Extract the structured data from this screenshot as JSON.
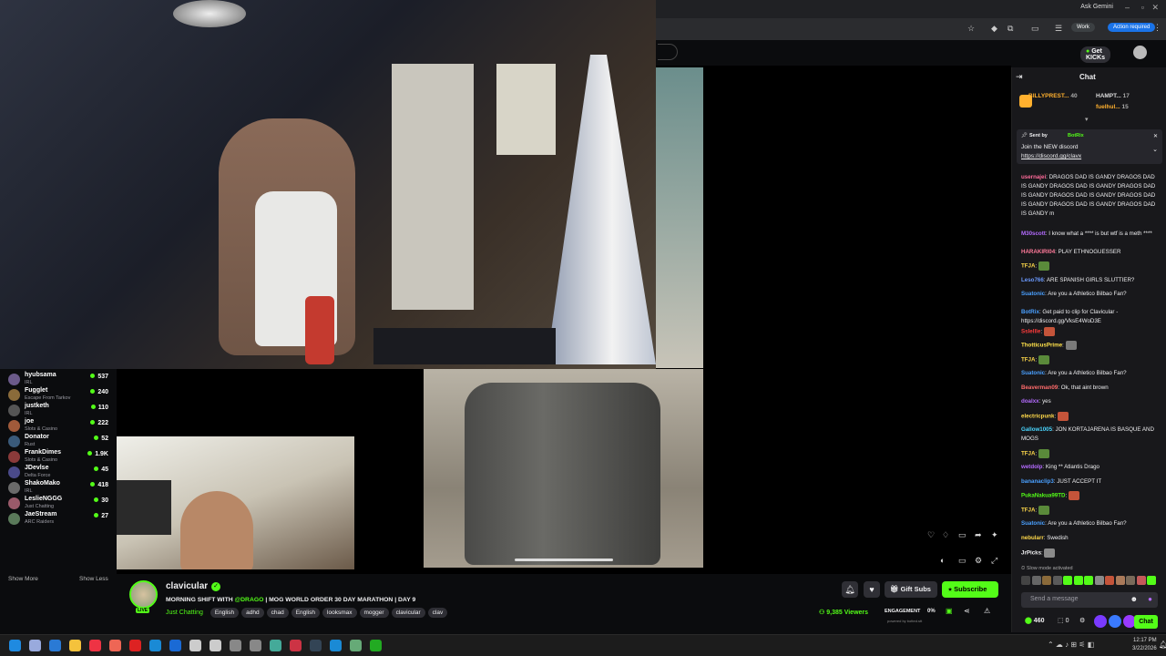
{
  "browser": {
    "ask_gemini": "Ask Gemini",
    "profile_chip": "Work",
    "action_required": "Action required"
  },
  "kick": {
    "get_kicks": "Get KICKs"
  },
  "sidebar": {
    "channels": [
      {
        "name": "hyubsama",
        "category": "IRL",
        "viewers": "537",
        "color": "#6b5a8a"
      },
      {
        "name": "Fugglet",
        "category": "Escape From Tarkov",
        "viewers": "240",
        "color": "#8a6b3a"
      },
      {
        "name": "justketh",
        "category": "IRL",
        "viewers": "110",
        "color": "#555"
      },
      {
        "name": "joe",
        "category": "Slots & Casino",
        "viewers": "222",
        "color": "#a05a3a"
      },
      {
        "name": "Donator",
        "category": "Rust",
        "viewers": "52",
        "color": "#3a5a7a"
      },
      {
        "name": "FrankDimes",
        "category": "Slots & Casino",
        "viewers": "1.9K",
        "color": "#8a3a3a"
      },
      {
        "name": "JDevlse",
        "category": "Delta Force",
        "viewers": "45",
        "color": "#4a4a8a"
      },
      {
        "name": "ShakoMako",
        "category": "IRL",
        "viewers": "418",
        "color": "#6a6a6a"
      },
      {
        "name": "LeslieNGGG",
        "category": "Just Chatting",
        "viewers": "30",
        "color": "#9a5a6a"
      },
      {
        "name": "JaeStream",
        "category": "ARC Raiders",
        "viewers": "27",
        "color": "#5a7a5a"
      }
    ],
    "show_more": "Show More",
    "show_less": "Show Less"
  },
  "stream": {
    "live_badge": "LIVE",
    "streamer": "clavicular",
    "title_prefix": "MORNING SHIFT WITH",
    "title_mention": "@DRAGO",
    "title_suffix": "| MOG WORLD ORDER 30 DAY MARATHON | DAY 9",
    "category": "Just Chatting",
    "tags": [
      "English",
      "adhd",
      "chad",
      "English",
      "looksmax",
      "mogger",
      "clavicular",
      "clav"
    ],
    "viewers": "9,385 Viewers",
    "engagement_label": "ENGAGEMENT",
    "engagement_value": "0%",
    "powered_by": "powered by botted.stt",
    "gift_subs": "Gift Subs",
    "subscribe": "Subscribe"
  },
  "chat": {
    "header": "Chat",
    "leaders": [
      {
        "name": "BILLYPREST...",
        "points": "40"
      },
      {
        "name": "HAMPT...",
        "points": "17"
      },
      {
        "name": "fuelhul...",
        "points": "15"
      }
    ],
    "pinned": {
      "sent_by": "Sent by",
      "bot": "BotRix",
      "line1": "Join the NEW discord",
      "link": "https://discord.gg/clavx"
    },
    "messages": [
      {
        "user": "usernajei",
        "color": "#ff6b9a",
        "text": "DRAGOS DAD IS GANDY DRAGOS DAD IS GANDY DRAGOS DAD IS GANDY DRAGOS DAD IS GANDY DRAGOS DAD IS GANDY DRAGOS DAD IS GANDY DRAGOS DAD IS GANDY DRAGOS DAD IS GANDY m"
      },
      {
        "user": "M30scott",
        "color": "#b46bff",
        "text": "I know what a **** is but wtf is a meth ****"
      },
      {
        "user": "HARAKIRI04",
        "color": "#ff7a9a",
        "text": "PLAY ETHNOGUESSER"
      },
      {
        "user": "TFJA",
        "color": "#ffd94a",
        "text": ""
      },
      {
        "user": "Leso766",
        "color": "#6b9aff",
        "text": "ARE SPANISH GIRLS SLUTTIER?"
      },
      {
        "user": "Suatonic",
        "color": "#4aa0ff",
        "text": "Are you a Athletico Bilbao Fan?"
      },
      {
        "user": "BotRix",
        "color": "#4aa0ff",
        "text": "Get paid to clip for Clavicular - https://discord.gg/VksE4WoD3E"
      },
      {
        "user": "Sslellle",
        "color": "#ff3b3b",
        "text": ""
      },
      {
        "user": "ThotticusPrime",
        "color": "#ffe14a",
        "text": ""
      },
      {
        "user": "TFJA",
        "color": "#ffd94a",
        "text": ""
      },
      {
        "user": "Suatonic",
        "color": "#4aa0ff",
        "text": "Are you a Athletico Bilbao Fan?"
      },
      {
        "user": "Beaverman09",
        "color": "#ff6b6b",
        "text": "Ok, that aint brown"
      },
      {
        "user": "doalxx",
        "color": "#b46bff",
        "text": "yes"
      },
      {
        "user": "electricpunk",
        "color": "#ffd94a",
        "text": ""
      },
      {
        "user": "Gallow1005",
        "color": "#4ad6ff",
        "text": "JON KORTAJARENA IS BASQUE AND MOGS"
      },
      {
        "user": "TFJA",
        "color": "#ffd94a",
        "text": ""
      },
      {
        "user": "wetdolp",
        "color": "#b46bff",
        "text": "King ** Atlantis Drago"
      },
      {
        "user": "bananaclip3",
        "color": "#4aa0ff",
        "text": "JUST ACCEPT IT"
      },
      {
        "user": "PukaNakua99TD",
        "color": "#53fc18",
        "text": ""
      },
      {
        "user": "TFJA",
        "color": "#ffd94a",
        "text": ""
      },
      {
        "user": "Suatonic",
        "color": "#4aa0ff",
        "text": "Are you a Athletico Bilbao Fan?"
      },
      {
        "user": "nebularr",
        "color": "#ffd94a",
        "text": "Swedish"
      },
      {
        "user": "JrPicks",
        "color": "#efeff1",
        "text": ""
      }
    ],
    "slow_mode": "Slow mode activated",
    "placeholder": "Send a message",
    "points": "460",
    "gifts": "0",
    "chat_button": "Chat"
  },
  "taskbar": {
    "time": "12:17 PM",
    "date": "3/22/2026"
  }
}
